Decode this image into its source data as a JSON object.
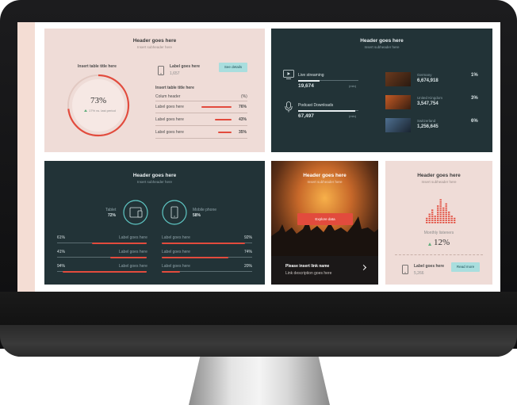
{
  "card1": {
    "header": "Header goes here",
    "subheader": "Insert subheader here",
    "table_title_left": "Insert table title here",
    "gauge_value": "73%",
    "gauge_fraction": 0.73,
    "gauge_note": "17% vs. last period",
    "device_label": "Label goes here",
    "device_value": "1,657",
    "see_details": "See details",
    "table_title": "Insert table title here",
    "column_header": "Colum header",
    "column_unit": "(%)",
    "rows": [
      {
        "label": "Label goes here",
        "value": "76%",
        "fraction": 0.76
      },
      {
        "label": "Label goes here",
        "value": "43%",
        "fraction": 0.43
      },
      {
        "label": "Label goes here",
        "value": "35%",
        "fraction": 0.35
      }
    ]
  },
  "card2": {
    "header": "Header goes here",
    "subheader": "Insert subheader here",
    "items": [
      {
        "label": "Live streaming",
        "value": "19,674",
        "unit": "(min)",
        "fraction": 0.35
      },
      {
        "label": "Podcast Downloads",
        "value": "67,497",
        "unit": "(min)",
        "fraction": 0.95
      }
    ],
    "countries": [
      {
        "name": "Germany",
        "value": "6,674,918",
        "pct": "1%"
      },
      {
        "name": "United Kingdom",
        "value": "3,547,754",
        "pct": "3%"
      },
      {
        "name": "Switzerland",
        "value": "1,256,645",
        "pct": "6%"
      }
    ]
  },
  "card3": {
    "header": "Header goes here",
    "subheader": "Insert subheader here",
    "tablet_label": "Tablet",
    "tablet_value": "72%",
    "mobile_label": "Mobile phone",
    "mobile_value": "58%",
    "rows_left": [
      {
        "pct": "61%",
        "label": "Label goes here",
        "fraction": 0.61
      },
      {
        "pct": "41%",
        "label": "Label goes here",
        "fraction": 0.41
      },
      {
        "pct": "94%",
        "label": "Label goes here",
        "fraction": 0.94
      }
    ],
    "rows_right": [
      {
        "label": "Label goes here",
        "pct": "92%",
        "fraction": 0.92
      },
      {
        "label": "Label goes here",
        "pct": "74%",
        "fraction": 0.74
      },
      {
        "label": "Label goes here",
        "pct": "20%",
        "fraction": 0.2
      }
    ]
  },
  "card4": {
    "header": "Header goes here",
    "subheader": "Insert subheader here",
    "button": "Explore data",
    "link_name": "Please insert link name",
    "link_desc": "Link description goes here"
  },
  "card5": {
    "header": "Header goes here",
    "subheader": "Insert subheader here",
    "caption": "Monthly listeners",
    "value": "12%",
    "label": "Label goes here",
    "label_value": "5,266",
    "button": "Read more"
  },
  "colors": {
    "accent": "#e24b3d",
    "teal": "#5fc7c4",
    "dark": "#223337",
    "pink": "#efdcd7",
    "button": "#a9dede"
  }
}
